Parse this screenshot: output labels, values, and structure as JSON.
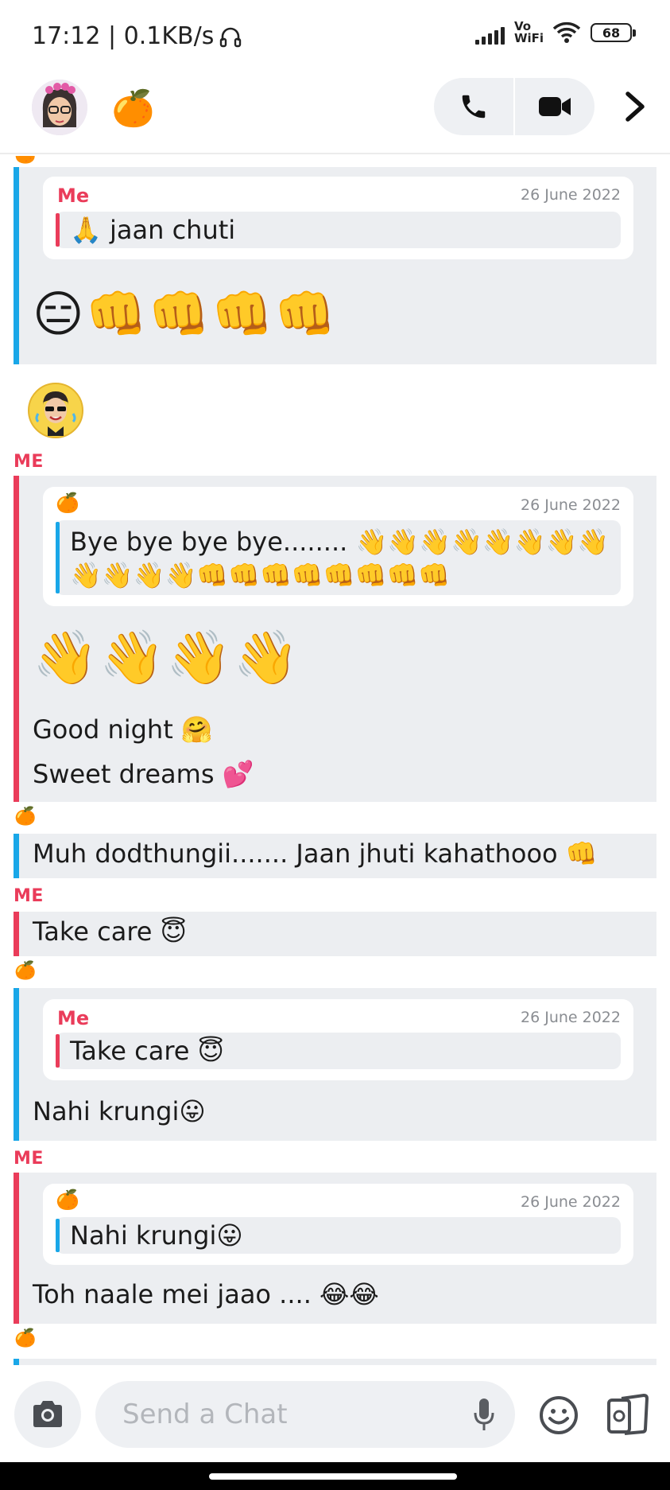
{
  "status_bar": {
    "time_speed": "17:12 | 0.1KB/s",
    "network": "Vo WiFi",
    "battery": "68"
  },
  "header": {
    "contact_emoji": "🍊"
  },
  "messages": [
    {
      "quote_name": "Me",
      "quote_date": "26 June 2022",
      "quote_text": "🙏 jaan chuti",
      "emoji_row": "😑👊👊👊👊"
    },
    {
      "sender": "ME",
      "quote_sender_emoji": "🍊",
      "quote_date": "26 June 2022",
      "quote_text": "Bye bye bye bye........ 👋👋👋👋👋👋👋👋👋👋👋👋👊👊👊👊👊👊👊👊",
      "emoji_row": "👋👋👋👋",
      "line1": "Good night 🤗",
      "line2": "Sweet dreams 💕"
    },
    {
      "sender_emoji": "🍊",
      "text": "Muh dodthungii....... Jaan jhuti kahathooo 👊"
    },
    {
      "sender": "ME",
      "text": "Take care 😇"
    },
    {
      "sender_emoji": "🍊",
      "quote_name": "Me",
      "quote_date": "26 June 2022",
      "quote_text": "Take care 😇",
      "text": "Nahi krungi😛"
    },
    {
      "sender": "ME",
      "quote_sender_emoji": "🍊",
      "quote_date": "26 June 2022",
      "quote_text": "Nahi krungi😛",
      "text": "Toh naale mei jaao .... 😂😂"
    },
    {
      "sender_emoji": "🍊"
    }
  ],
  "composer": {
    "placeholder": "Send a Chat"
  },
  "colors": {
    "me_red": "#ea3c5a",
    "friend_blue": "#19a7e8",
    "bubble_gray": "#eceef1"
  },
  "icons": [
    "headphones-icon",
    "signal-icon",
    "wifi-icon",
    "battery-icon",
    "phone-icon",
    "video-icon",
    "chevron-right-icon",
    "camera-icon",
    "mic-icon",
    "smiley-icon",
    "cards-icon"
  ]
}
